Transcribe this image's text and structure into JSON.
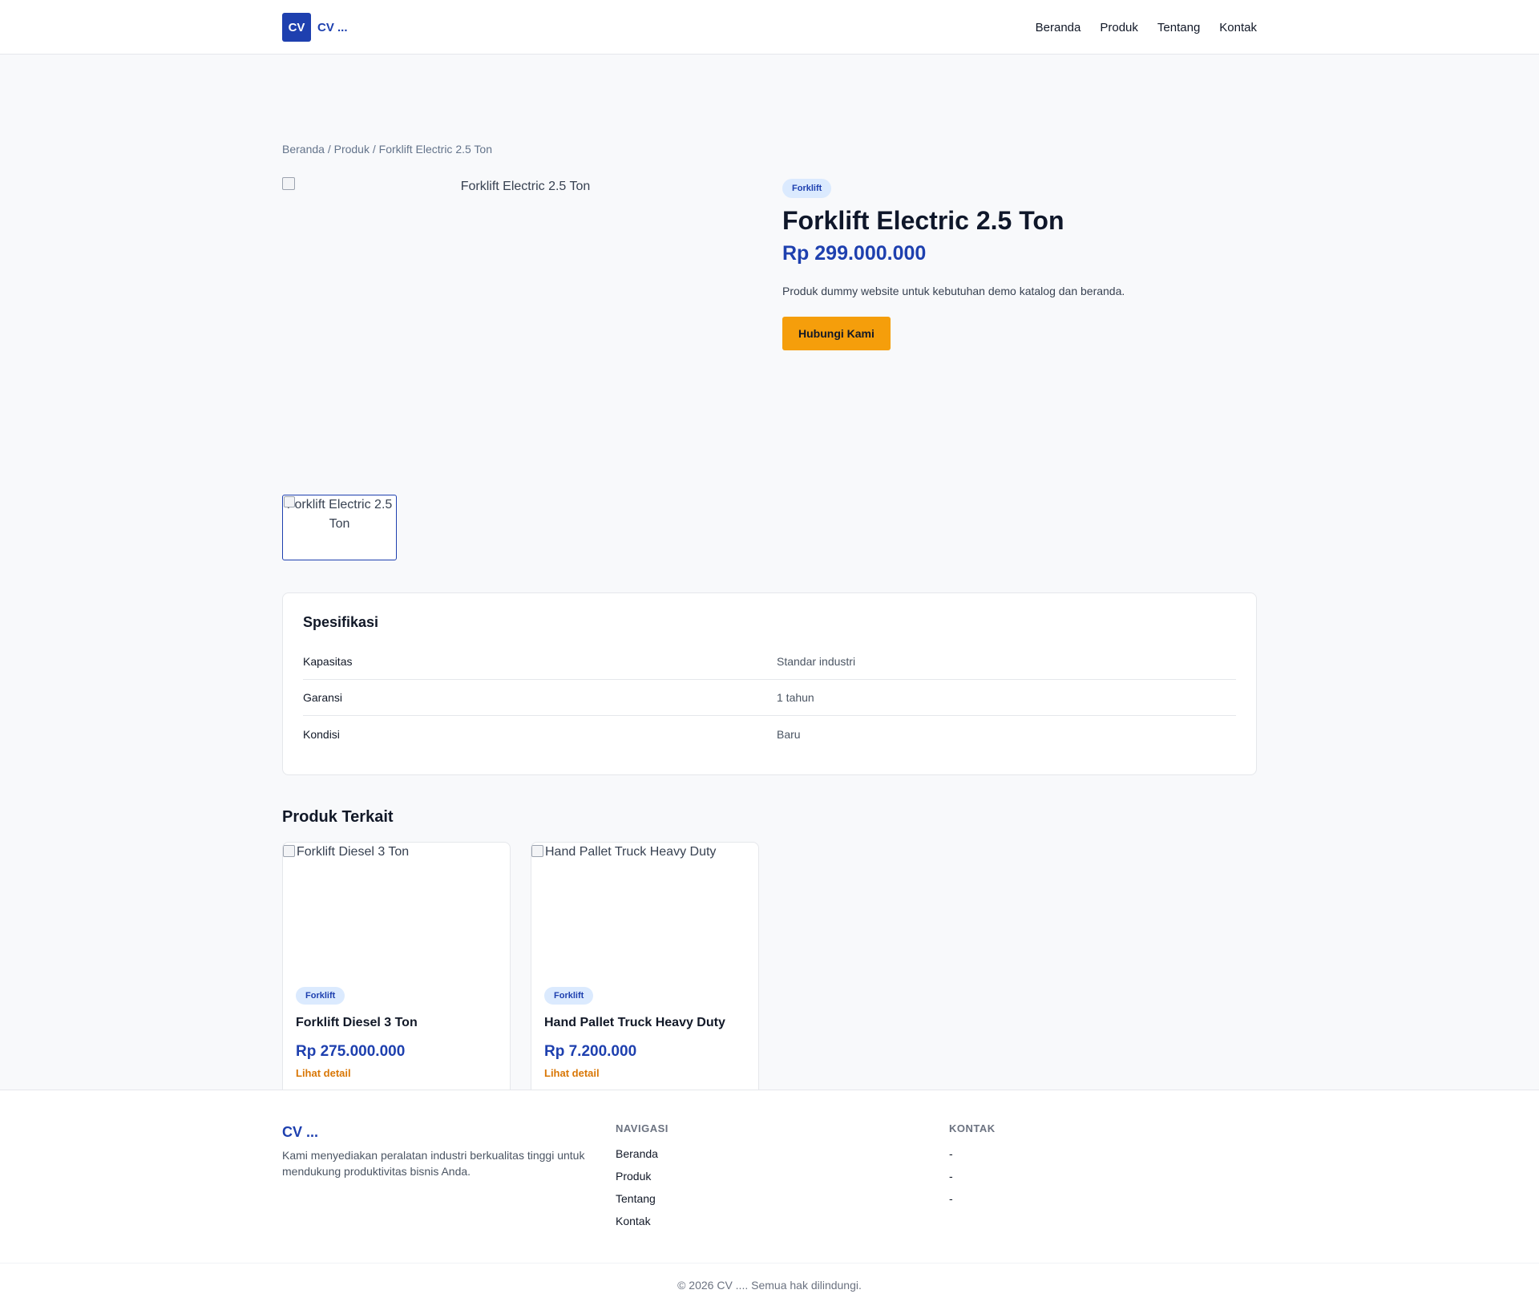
{
  "header": {
    "logo_text": "CV",
    "brand_name": "CV ...",
    "nav": [
      "Beranda",
      "Produk",
      "Tentang",
      "Kontak"
    ]
  },
  "breadcrumb": [
    "Beranda",
    "Produk",
    "Forklift Electric 2.5 Ton"
  ],
  "product": {
    "image_alt": "Forklift Electric 2.5 Ton",
    "thumb_alt": "Forklift Electric 2.5 Ton",
    "category": "Forklift",
    "title": "Forklift Electric 2.5 Ton",
    "price": "Rp 299.000.000",
    "description": "Produk dummy website untuk kebutuhan demo katalog dan beranda.",
    "cta_label": "Hubungi Kami"
  },
  "specs": {
    "title": "Spesifikasi",
    "rows": [
      {
        "key": "Kapasitas",
        "value": "Standar industri"
      },
      {
        "key": "Garansi",
        "value": "1 tahun"
      },
      {
        "key": "Kondisi",
        "value": "Baru"
      }
    ]
  },
  "related": {
    "title": "Produk Terkait",
    "items": [
      {
        "image_alt": "Forklift Diesel 3 Ton",
        "category": "Forklift",
        "name": "Forklift Diesel 3 Ton",
        "price": "Rp 275.000.000",
        "link": "Lihat detail"
      },
      {
        "image_alt": "Hand Pallet Truck Heavy Duty",
        "category": "Forklift",
        "name": "Hand Pallet Truck Heavy Duty",
        "price": "Rp 7.200.000",
        "link": "Lihat detail"
      }
    ]
  },
  "footer": {
    "brand": "CV ...",
    "description": "Kami menyediakan peralatan industri berkualitas tinggi untuk mendukung produktivitas bisnis Anda.",
    "nav_heading": "NAVIGASI",
    "nav_items": [
      "Beranda",
      "Produk",
      "Tentang",
      "Kontak"
    ],
    "contact_heading": "KONTAK",
    "contact_items": [
      "-",
      "-",
      "-"
    ],
    "copyright": "© 2026 CV .... Semua hak dilindungi."
  },
  "colors": {
    "primary": "#1e40af",
    "accent": "#f59e0b",
    "link_orange": "#d97706",
    "badge_bg": "#dbeafe",
    "page_bg": "#f8f9fb"
  }
}
